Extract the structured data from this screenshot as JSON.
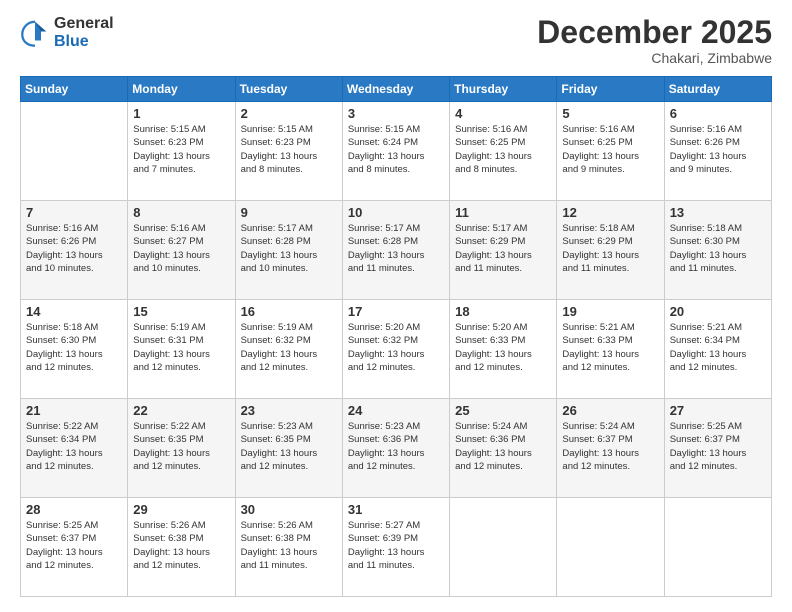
{
  "logo": {
    "general": "General",
    "blue": "Blue"
  },
  "header": {
    "month": "December 2025",
    "location": "Chakari, Zimbabwe"
  },
  "weekdays": [
    "Sunday",
    "Monday",
    "Tuesday",
    "Wednesday",
    "Thursday",
    "Friday",
    "Saturday"
  ],
  "weeks": [
    [
      {
        "day": "",
        "info": ""
      },
      {
        "day": "1",
        "info": "Sunrise: 5:15 AM\nSunset: 6:23 PM\nDaylight: 13 hours\nand 7 minutes."
      },
      {
        "day": "2",
        "info": "Sunrise: 5:15 AM\nSunset: 6:23 PM\nDaylight: 13 hours\nand 8 minutes."
      },
      {
        "day": "3",
        "info": "Sunrise: 5:15 AM\nSunset: 6:24 PM\nDaylight: 13 hours\nand 8 minutes."
      },
      {
        "day": "4",
        "info": "Sunrise: 5:16 AM\nSunset: 6:25 PM\nDaylight: 13 hours\nand 8 minutes."
      },
      {
        "day": "5",
        "info": "Sunrise: 5:16 AM\nSunset: 6:25 PM\nDaylight: 13 hours\nand 9 minutes."
      },
      {
        "day": "6",
        "info": "Sunrise: 5:16 AM\nSunset: 6:26 PM\nDaylight: 13 hours\nand 9 minutes."
      }
    ],
    [
      {
        "day": "7",
        "info": "Sunrise: 5:16 AM\nSunset: 6:26 PM\nDaylight: 13 hours\nand 10 minutes."
      },
      {
        "day": "8",
        "info": "Sunrise: 5:16 AM\nSunset: 6:27 PM\nDaylight: 13 hours\nand 10 minutes."
      },
      {
        "day": "9",
        "info": "Sunrise: 5:17 AM\nSunset: 6:28 PM\nDaylight: 13 hours\nand 10 minutes."
      },
      {
        "day": "10",
        "info": "Sunrise: 5:17 AM\nSunset: 6:28 PM\nDaylight: 13 hours\nand 11 minutes."
      },
      {
        "day": "11",
        "info": "Sunrise: 5:17 AM\nSunset: 6:29 PM\nDaylight: 13 hours\nand 11 minutes."
      },
      {
        "day": "12",
        "info": "Sunrise: 5:18 AM\nSunset: 6:29 PM\nDaylight: 13 hours\nand 11 minutes."
      },
      {
        "day": "13",
        "info": "Sunrise: 5:18 AM\nSunset: 6:30 PM\nDaylight: 13 hours\nand 11 minutes."
      }
    ],
    [
      {
        "day": "14",
        "info": "Sunrise: 5:18 AM\nSunset: 6:30 PM\nDaylight: 13 hours\nand 12 minutes."
      },
      {
        "day": "15",
        "info": "Sunrise: 5:19 AM\nSunset: 6:31 PM\nDaylight: 13 hours\nand 12 minutes."
      },
      {
        "day": "16",
        "info": "Sunrise: 5:19 AM\nSunset: 6:32 PM\nDaylight: 13 hours\nand 12 minutes."
      },
      {
        "day": "17",
        "info": "Sunrise: 5:20 AM\nSunset: 6:32 PM\nDaylight: 13 hours\nand 12 minutes."
      },
      {
        "day": "18",
        "info": "Sunrise: 5:20 AM\nSunset: 6:33 PM\nDaylight: 13 hours\nand 12 minutes."
      },
      {
        "day": "19",
        "info": "Sunrise: 5:21 AM\nSunset: 6:33 PM\nDaylight: 13 hours\nand 12 minutes."
      },
      {
        "day": "20",
        "info": "Sunrise: 5:21 AM\nSunset: 6:34 PM\nDaylight: 13 hours\nand 12 minutes."
      }
    ],
    [
      {
        "day": "21",
        "info": "Sunrise: 5:22 AM\nSunset: 6:34 PM\nDaylight: 13 hours\nand 12 minutes."
      },
      {
        "day": "22",
        "info": "Sunrise: 5:22 AM\nSunset: 6:35 PM\nDaylight: 13 hours\nand 12 minutes."
      },
      {
        "day": "23",
        "info": "Sunrise: 5:23 AM\nSunset: 6:35 PM\nDaylight: 13 hours\nand 12 minutes."
      },
      {
        "day": "24",
        "info": "Sunrise: 5:23 AM\nSunset: 6:36 PM\nDaylight: 13 hours\nand 12 minutes."
      },
      {
        "day": "25",
        "info": "Sunrise: 5:24 AM\nSunset: 6:36 PM\nDaylight: 13 hours\nand 12 minutes."
      },
      {
        "day": "26",
        "info": "Sunrise: 5:24 AM\nSunset: 6:37 PM\nDaylight: 13 hours\nand 12 minutes."
      },
      {
        "day": "27",
        "info": "Sunrise: 5:25 AM\nSunset: 6:37 PM\nDaylight: 13 hours\nand 12 minutes."
      }
    ],
    [
      {
        "day": "28",
        "info": "Sunrise: 5:25 AM\nSunset: 6:37 PM\nDaylight: 13 hours\nand 12 minutes."
      },
      {
        "day": "29",
        "info": "Sunrise: 5:26 AM\nSunset: 6:38 PM\nDaylight: 13 hours\nand 12 minutes."
      },
      {
        "day": "30",
        "info": "Sunrise: 5:26 AM\nSunset: 6:38 PM\nDaylight: 13 hours\nand 11 minutes."
      },
      {
        "day": "31",
        "info": "Sunrise: 5:27 AM\nSunset: 6:39 PM\nDaylight: 13 hours\nand 11 minutes."
      },
      {
        "day": "",
        "info": ""
      },
      {
        "day": "",
        "info": ""
      },
      {
        "day": "",
        "info": ""
      }
    ]
  ]
}
